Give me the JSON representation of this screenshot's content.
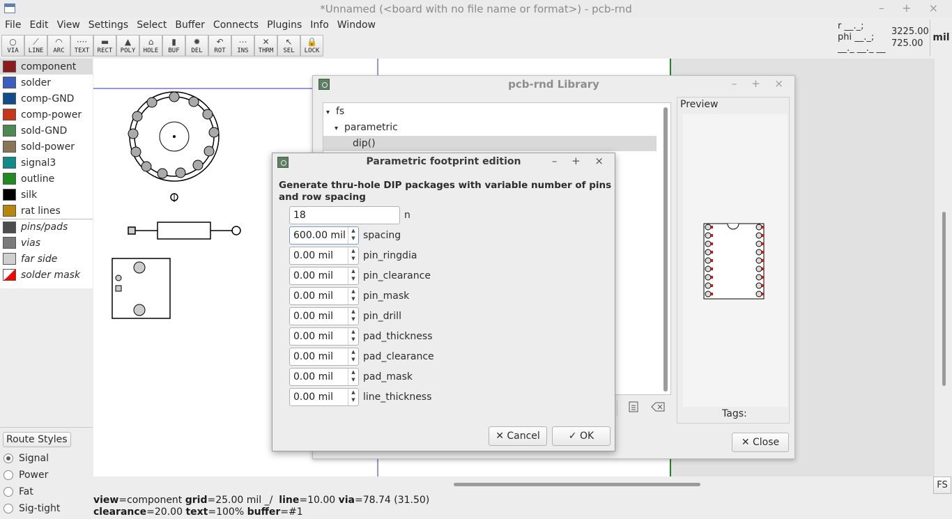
{
  "window": {
    "title": "*Unnamed (<board with no file name or format>) - pcb-rnd",
    "controls": "– + ×"
  },
  "menu": [
    "File",
    "Edit",
    "View",
    "Settings",
    "Select",
    "Buffer",
    "Connects",
    "Plugins",
    "Info",
    "Window"
  ],
  "toolbar": [
    {
      "label": "VIA",
      "icon": "via-icon",
      "glyph": "○"
    },
    {
      "label": "LINE",
      "icon": "line-icon",
      "glyph": "⟋"
    },
    {
      "label": "ARC",
      "icon": "arc-icon",
      "glyph": "◠"
    },
    {
      "label": "TEXT",
      "icon": "text-icon",
      "glyph": "····"
    },
    {
      "label": "RECT",
      "icon": "rect-icon",
      "glyph": "▬"
    },
    {
      "label": "POLY",
      "icon": "poly-icon",
      "glyph": "▲"
    },
    {
      "label": "HOLE",
      "icon": "hole-icon",
      "glyph": "⌂"
    },
    {
      "label": "BUF",
      "icon": "buffer-icon",
      "glyph": "▮"
    },
    {
      "label": "DEL",
      "icon": "delete-icon",
      "glyph": "✹"
    },
    {
      "label": "ROT",
      "icon": "rotate-icon",
      "glyph": "↶"
    },
    {
      "label": "INS",
      "icon": "insert-icon",
      "glyph": "⋯"
    },
    {
      "label": "THRM",
      "icon": "thermal-icon",
      "glyph": "✕"
    },
    {
      "label": "SEL",
      "icon": "select-icon",
      "glyph": "↖"
    },
    {
      "label": "LOCK",
      "icon": "lock-icon",
      "glyph": "🔒"
    }
  ],
  "coords": {
    "r_line": "r __._;",
    "phi_line": "phi __._;",
    "dash_line": "__._ __._ __",
    "x": "3225.00",
    "y": "725.00",
    "unit": "mil"
  },
  "layers": [
    {
      "name": "component",
      "color": "#8b1a1a",
      "selected": true,
      "italic": false
    },
    {
      "name": "solder",
      "color": "#3b5fc0",
      "selected": false,
      "italic": false
    },
    {
      "name": "comp-GND",
      "color": "#0e4c8c",
      "selected": false,
      "italic": false
    },
    {
      "name": "comp-power",
      "color": "#c8371a",
      "selected": false,
      "italic": false
    },
    {
      "name": "sold-GND",
      "color": "#4c8a52",
      "selected": false,
      "italic": false
    },
    {
      "name": "sold-power",
      "color": "#8a7554",
      "selected": false,
      "italic": false
    },
    {
      "name": "signal3",
      "color": "#0e8c8c",
      "selected": false,
      "italic": false
    },
    {
      "name": "outline",
      "color": "#1f8c1f",
      "selected": false,
      "italic": false
    },
    {
      "name": "silk",
      "color": "#000000",
      "selected": false,
      "italic": false
    },
    {
      "name": "rat lines",
      "color": "#b8860b",
      "selected": false,
      "italic": false
    },
    {
      "name": "pins/pads",
      "color": "#4d4d4d",
      "selected": false,
      "italic": true
    },
    {
      "name": "vias",
      "color": "#7a7a7a",
      "selected": false,
      "italic": true
    },
    {
      "name": "far side",
      "color": "#cfcfcf",
      "selected": false,
      "italic": true
    },
    {
      "name": "solder mask",
      "color": "#ff0000",
      "selected": false,
      "italic": true
    }
  ],
  "route_styles": {
    "button": "Route Styles",
    "options": [
      {
        "label": "Signal",
        "checked": true
      },
      {
        "label": "Power",
        "checked": false
      },
      {
        "label": "Fat",
        "checked": false
      },
      {
        "label": "Sig-tight",
        "checked": false
      }
    ]
  },
  "status": {
    "line1": {
      "view": "component",
      "grid": "25.00 mil",
      "grid_tail": "_/",
      "line": "10.00",
      "via": "78.74 (31.50)"
    },
    "line2": {
      "clearance": "20.00",
      "text": "100%",
      "buffer": "#1"
    }
  },
  "fs_button": "FS",
  "library": {
    "title": "pcb-rnd Library",
    "controls": "– + ×",
    "tree": [
      {
        "label": "fs",
        "level": 0,
        "arrow": "▾"
      },
      {
        "label": "parametric",
        "level": 1,
        "arrow": "▾"
      },
      {
        "label": "dip()",
        "level": 2,
        "arrow": "",
        "selected": true
      }
    ],
    "preview_label": "Preview",
    "tags_label": "Tags:",
    "close_label": "Close"
  },
  "param_dialog": {
    "title": "Parametric footprint edition",
    "controls": "– + ×",
    "description": "Generate thru-hole DIP packages with variable number of pins and row spacing",
    "fields": [
      {
        "value": "18",
        "name": "n",
        "spin": false
      },
      {
        "value": "600.00 mil",
        "name": "spacing",
        "spin": true,
        "focus": true
      },
      {
        "value": "0.00 mil",
        "name": "pin_ringdia",
        "spin": true
      },
      {
        "value": "0.00 mil",
        "name": "pin_clearance",
        "spin": true
      },
      {
        "value": "0.00 mil",
        "name": "pin_mask",
        "spin": true
      },
      {
        "value": "0.00 mil",
        "name": "pin_drill",
        "spin": true
      },
      {
        "value": "0.00 mil",
        "name": "pad_thickness",
        "spin": true
      },
      {
        "value": "0.00 mil",
        "name": "pad_clearance",
        "spin": true
      },
      {
        "value": "0.00 mil",
        "name": "pad_mask",
        "spin": true
      },
      {
        "value": "0.00 mil",
        "name": "line_thickness",
        "spin": true
      }
    ],
    "cancel_label": "Cancel",
    "ok_label": "OK"
  }
}
